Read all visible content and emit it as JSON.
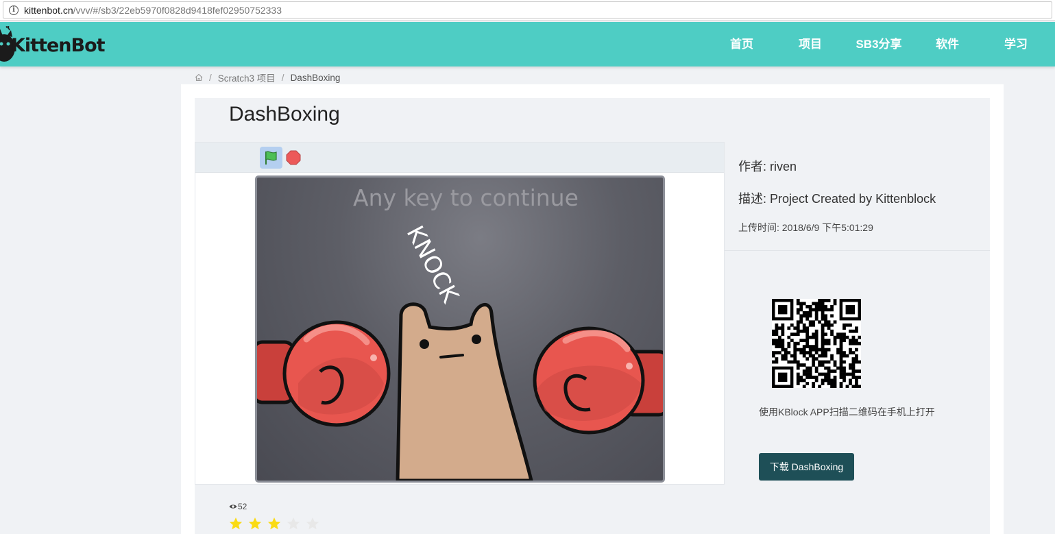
{
  "browser": {
    "url_host": "kittenbot.cn",
    "url_path": "/vvv/#/sb3/22eb5970f0828d9418fef02950752333"
  },
  "header": {
    "logo_text": "KittenBot",
    "nav": [
      "首页",
      "项目",
      "SB3分享",
      "软件",
      "学习"
    ]
  },
  "breadcrumb": {
    "items": [
      "Scratch3 项目",
      "DashBoxing"
    ]
  },
  "project": {
    "title": "DashBoxing",
    "author": "作者: riven",
    "description": "描述: Project Created by Kittenblock",
    "uploaded": "上传时间: 2018/6/9 下午5:01:29",
    "qr_caption": "使用KBlock APP扫描二维码在手机上打开",
    "download_label": "下载 DashBoxing",
    "views": "52",
    "rating": 3,
    "rating_max": 5
  },
  "stage": {
    "prompt_text": "Any key to continue",
    "knock_text": "KNOCK"
  },
  "colors": {
    "header": "#4ecdc4",
    "download_button": "#1e4f57",
    "star_filled": "#fadb14",
    "star_empty": "#e8e8e8",
    "glove": "#e8564f",
    "character": "#d3ab8c"
  }
}
